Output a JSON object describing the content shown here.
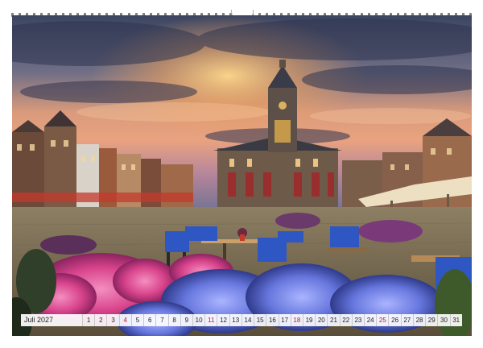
{
  "calendar": {
    "month_label": "Juli 2027",
    "days": [
      {
        "n": "1",
        "sunday": false
      },
      {
        "n": "2",
        "sunday": false
      },
      {
        "n": "3",
        "sunday": false
      },
      {
        "n": "4",
        "sunday": true
      },
      {
        "n": "5",
        "sunday": false
      },
      {
        "n": "6",
        "sunday": false
      },
      {
        "n": "7",
        "sunday": false
      },
      {
        "n": "8",
        "sunday": false
      },
      {
        "n": "9",
        "sunday": false
      },
      {
        "n": "10",
        "sunday": false
      },
      {
        "n": "11",
        "sunday": true
      },
      {
        "n": "12",
        "sunday": false
      },
      {
        "n": "13",
        "sunday": false
      },
      {
        "n": "14",
        "sunday": false
      },
      {
        "n": "15",
        "sunday": false
      },
      {
        "n": "16",
        "sunday": false
      },
      {
        "n": "17",
        "sunday": false
      },
      {
        "n": "18",
        "sunday": true
      },
      {
        "n": "19",
        "sunday": false
      },
      {
        "n": "20",
        "sunday": false
      },
      {
        "n": "21",
        "sunday": false
      },
      {
        "n": "22",
        "sunday": false
      },
      {
        "n": "23",
        "sunday": false
      },
      {
        "n": "24",
        "sunday": false
      },
      {
        "n": "25",
        "sunday": true
      },
      {
        "n": "26",
        "sunday": false
      },
      {
        "n": "27",
        "sunday": false
      },
      {
        "n": "28",
        "sunday": false
      },
      {
        "n": "29",
        "sunday": false
      },
      {
        "n": "30",
        "sunday": false
      },
      {
        "n": "31",
        "sunday": false
      }
    ]
  },
  "colors": {
    "sunday": "#c8102e",
    "sky_top": "#3f4760",
    "sky_glow": "#f3b46a",
    "hydrangea_pink": "#e0559a",
    "hydrangea_blue": "#6f7fe0",
    "chair_blue": "#2f57c4"
  },
  "binding": {
    "icon": "spiral-binding-icon"
  }
}
